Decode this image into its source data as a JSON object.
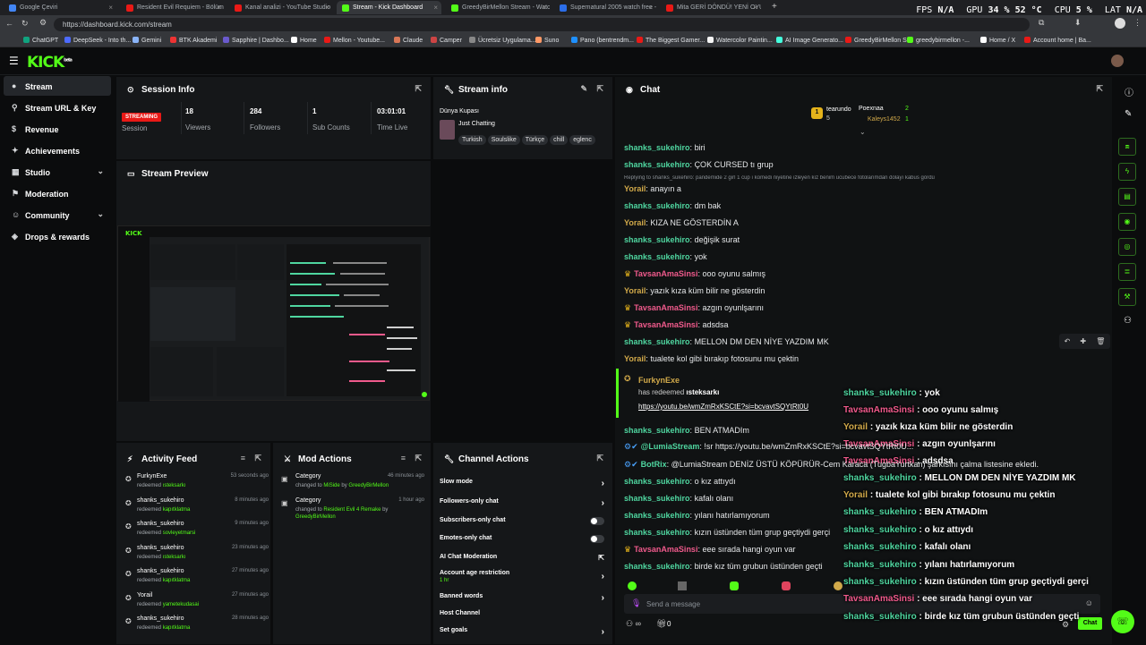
{
  "browser": {
    "tabs": [
      {
        "label": "Google Çeviri",
        "color": "#4285f4"
      },
      {
        "label": "Resident Evil Requiem - Bölüm 5",
        "color": "#e91916"
      },
      {
        "label": "Kanal analizi - YouTube Studio",
        "color": "#e91916"
      },
      {
        "label": "Stream - Kick Dashboard",
        "color": "#53fc18"
      },
      {
        "label": "GreedyBirMellon Stream - Watch",
        "color": "#53fc18"
      },
      {
        "label": "Supernatural 2005 watch free - fs",
        "color": "#2b6de8"
      },
      {
        "label": "Mita GERİ DÖNDÜ! YENİ OYUN M",
        "color": "#e91916"
      }
    ],
    "hud": {
      "fps_label": "FPS",
      "fps": "N/A",
      "gpu_label": "GPU",
      "gpu": "34 %  52 °C",
      "cpu_label": "CPU",
      "cpu": "5 %",
      "lat_label": "LAT",
      "lat": "N/A"
    },
    "url": "https://dashboard.kick.com/stream",
    "bookmarks": [
      "ChatGPT",
      "DeepSeek - Into th...",
      "Gemini",
      "BTK Akademi",
      "Sapphire | Dashbo...",
      "Home",
      "Mellon - Youtube...",
      "Claude",
      "Camper",
      "Ücretsiz Uygulama...",
      "Suno",
      "Pano (bentrendm...",
      "The Biggest Gamer...",
      "Watercolor Paintin...",
      "AI Image Generato...",
      "GreedyBirMellon S...",
      "greedybirmellon -...",
      "Home / X",
      "Account home | Ba..."
    ]
  },
  "app": {
    "logo": "KICK",
    "logo_sup": "beta"
  },
  "sidebar": {
    "items": [
      {
        "label": "Stream",
        "icon": "●"
      },
      {
        "label": "Stream URL & Key",
        "icon": "⚲"
      },
      {
        "label": "Revenue",
        "icon": "$"
      },
      {
        "label": "Achievements",
        "icon": "✦"
      },
      {
        "label": "Studio",
        "icon": "▦",
        "chev": "⌄"
      },
      {
        "label": "Moderation",
        "icon": "⚑"
      },
      {
        "label": "Community",
        "icon": "☺",
        "chev": "⌄"
      },
      {
        "label": "Drops & rewards",
        "icon": "◈"
      }
    ]
  },
  "session": {
    "title": "Session Info",
    "status": "STREAMING",
    "session_label": "Session",
    "stats": [
      {
        "value": "18",
        "label": "Viewers"
      },
      {
        "value": "284",
        "label": "Followers"
      },
      {
        "value": "1",
        "label": "Sub Counts"
      },
      {
        "value": "03:01:01",
        "label": "Time Live"
      }
    ]
  },
  "stream_info": {
    "title": "Stream info",
    "stream_title": "Dünya Kupası",
    "category": "Just Chatting",
    "tags": [
      "Turkish",
      "Soulslike",
      "Türkçe",
      "chill",
      "eglenc"
    ]
  },
  "preview": {
    "title": "Stream Preview"
  },
  "activity": {
    "title": "Activity Feed",
    "items": [
      {
        "user": "FurkynExe",
        "verb": "redeemed",
        "reward": "ısteksarkı",
        "time": "53 seconds ago"
      },
      {
        "user": "shanks_sukehiro",
        "verb": "redeemed",
        "reward": "kapıtklatma",
        "time": "8 minutes ago"
      },
      {
        "user": "shanks_sukehiro",
        "verb": "redeemed",
        "reward": "sovleyetmarsi",
        "time": "9 minutes ago"
      },
      {
        "user": "shanks_sukehiro",
        "verb": "redeemed",
        "reward": "ısteksarkı",
        "time": "23 minutes ago"
      },
      {
        "user": "shanks_sukehiro",
        "verb": "redeemed",
        "reward": "kapıtklatma",
        "time": "27 minutes ago"
      },
      {
        "user": "Yorail",
        "verb": "redeemed",
        "reward": "yametekudasai",
        "time": "27 minutes ago"
      },
      {
        "user": "shanks_sukehiro",
        "verb": "redeemed",
        "reward": "kapıtklatma",
        "time": "28 minutes ago"
      }
    ]
  },
  "mod_actions": {
    "title": "Mod Actions",
    "items": [
      {
        "label": "Category",
        "pre": "changed to",
        "value": "MiSide",
        "by": "by",
        "mod": "GreedyBirMellon",
        "time": "46 minutes ago"
      },
      {
        "label": "Category",
        "pre": "changed to",
        "value": "Resident Evil 4 Remake",
        "by": "by",
        "mod": "GreedyBirMellon",
        "time": "1 hour ago"
      }
    ]
  },
  "channel_actions": {
    "title": "Channel Actions",
    "items": [
      {
        "label": "Slow mode",
        "kind": "arrow"
      },
      {
        "label": "Followers-only chat",
        "kind": "arrow"
      },
      {
        "label": "Subscribers-only chat",
        "kind": "toggle"
      },
      {
        "label": "Emotes-only chat",
        "kind": "toggle"
      },
      {
        "label": "AI Chat Moderation",
        "kind": "ext"
      },
      {
        "label": "Account age restriction",
        "sub": "1 hr",
        "kind": "arrow"
      },
      {
        "label": "Banned words",
        "kind": "arrow"
      },
      {
        "label": "Host Channel",
        "kind": "none"
      },
      {
        "label": "Set goals",
        "kind": "arrow"
      }
    ]
  },
  "chat": {
    "title": "Chat",
    "leaderboard": {
      "top": {
        "name": "tearundo",
        "count": "5"
      },
      "second": {
        "name": "Poexnaa",
        "count": "2"
      },
      "third": {
        "name": "Kaleys1452",
        "count": "1"
      }
    },
    "reply_note": "Replying to shanks_sukehiro: pandemide 2 girl 1 cup ı komedi niyetine izleyen kız benim ucubece fotolarımdan dolayı kabus gördü",
    "messages": [
      {
        "user": "shanks_sukehiro",
        "color": "#4fd6a0",
        "text": "biri"
      },
      {
        "user": "shanks_sukehiro",
        "color": "#4fd6a0",
        "text": "ÇOK CURSED tı grup"
      },
      {
        "user": "Yorail",
        "color": "#d1a94a",
        "text": "anayın a"
      },
      {
        "user": "shanks_sukehiro",
        "color": "#4fd6a0",
        "text": "dm bak"
      },
      {
        "user": "Yorail",
        "color": "#d1a94a",
        "text": "KIZA NE GÖSTERDİN A"
      },
      {
        "user": "shanks_sukehiro",
        "color": "#4fd6a0",
        "text": "değişik surat"
      },
      {
        "user": "shanks_sukehiro",
        "color": "#4fd6a0",
        "text": "yok"
      },
      {
        "user": "TavsanAmaSinsi",
        "color": "#f05a8c",
        "text": "ooo oyunu salmış"
      },
      {
        "user": "Yorail",
        "color": "#d1a94a",
        "text": "yazık kıza küm bilir ne gösterdin"
      },
      {
        "user": "TavsanAmaSinsi",
        "color": "#f05a8c",
        "text": "azgın oyunlşarını"
      },
      {
        "user": "TavsanAmaSinsi",
        "color": "#f05a8c",
        "text": "adsdsa"
      },
      {
        "user": "shanks_sukehiro",
        "color": "#4fd6a0",
        "text": "MELLON DM DEN NİYE YAZDIM MK"
      },
      {
        "user": "Yorail",
        "color": "#d1a94a",
        "text": "tualete kol gibi bırakıp fotosunu mu çektin"
      }
    ],
    "redeem": {
      "user": "FurkynExe",
      "text": "has redeemed",
      "reward": "ısteksarkı",
      "link": "https://youtu.be/wmZmRxKSCtE?si=bcvavtSQYtRt0U"
    },
    "messages2": [
      {
        "user": "shanks_sukehiro",
        "color": "#4fd6a0",
        "text": "BEN ATMADIm"
      },
      {
        "user": "@LumiaStream",
        "color": "#4fd6a0",
        "text": "!sr https://youtu.be/wmZmRxKSCtE?si=bcvavtSQYtRt0U..."
      },
      {
        "user": "BotRix",
        "color": "#4fd6a0",
        "text": "@LumiaStream DENİZ ÜSTÜ KÖPÜRÜR-Cem Karaca (TugbaYurtkan) şarkısını çalma listesine ekledi."
      },
      {
        "user": "shanks_sukehiro",
        "color": "#4fd6a0",
        "text": "o kız attıydı"
      },
      {
        "user": "shanks_sukehiro",
        "color": "#4fd6a0",
        "text": "kafalı olanı"
      },
      {
        "user": "shanks_sukehiro",
        "color": "#4fd6a0",
        "text": "yılanı hatırlamıyorum"
      },
      {
        "user": "shanks_sukehiro",
        "color": "#4fd6a0",
        "text": "kızın üstünden tüm grup geçtiydi gerçi"
      },
      {
        "user": "TavsanAmaSinsi",
        "color": "#f05a8c",
        "text": "eee sırada hangi oyun var"
      },
      {
        "user": "shanks_sukehiro",
        "color": "#4fd6a0",
        "text": "birde kız tüm grubun üstünden geçti"
      }
    ],
    "overlay": [
      {
        "user": "shanks_sukehiro",
        "color": "#4fd6a0",
        "text": " : yok"
      },
      {
        "user": "TavsanAmaSinsi",
        "color": "#f05a8c",
        "text": " : ooo oyunu salmış"
      },
      {
        "user": "Yorail",
        "color": "#d1a94a",
        "text": " : yazık kıza küm bilir ne gösterdin"
      },
      {
        "user": "TavsanAmaSinsi",
        "color": "#f05a8c",
        "text": " : azgın oyunlşarını"
      },
      {
        "user": "TavsanAmaSinsi",
        "color": "#f05a8c",
        "text": " : adsdsa"
      },
      {
        "user": "shanks_sukehiro",
        "color": "#4fd6a0",
        "text": " : MELLON DM DEN NİYE YAZDIM MK"
      },
      {
        "user": "Yorail",
        "color": "#d1a94a",
        "text": " : tualete kol gibi bırakıp fotosunu mu çektin"
      },
      {
        "user": "shanks_sukehiro",
        "color": "#4fd6a0",
        "text": " : BEN ATMADIm"
      },
      {
        "user": "shanks_sukehiro",
        "color": "#4fd6a0",
        "text": " : o kız attıydı"
      },
      {
        "user": "shanks_sukehiro",
        "color": "#4fd6a0",
        "text": " : kafalı olanı"
      },
      {
        "user": "shanks_sukehiro",
        "color": "#4fd6a0",
        "text": " : yılanı hatırlamıyorum"
      },
      {
        "user": "shanks_sukehiro",
        "color": "#4fd6a0",
        "text": " : kızın üstünden tüm grup geçtiydi gerçi"
      },
      {
        "user": "TavsanAmaSinsi",
        "color": "#f05a8c",
        "text": " : eee sırada hangi oyun var"
      },
      {
        "user": "shanks_sukehiro",
        "color": "#4fd6a0",
        "text": " : birde kız tüm grubun üstünden geçti"
      }
    ],
    "input_placeholder": "Send a message",
    "footer_count": "0",
    "send_label": "Chat"
  },
  "colors": {
    "accent": "#53fc18",
    "panel": "#151719",
    "bg": "#0b0c0d"
  }
}
